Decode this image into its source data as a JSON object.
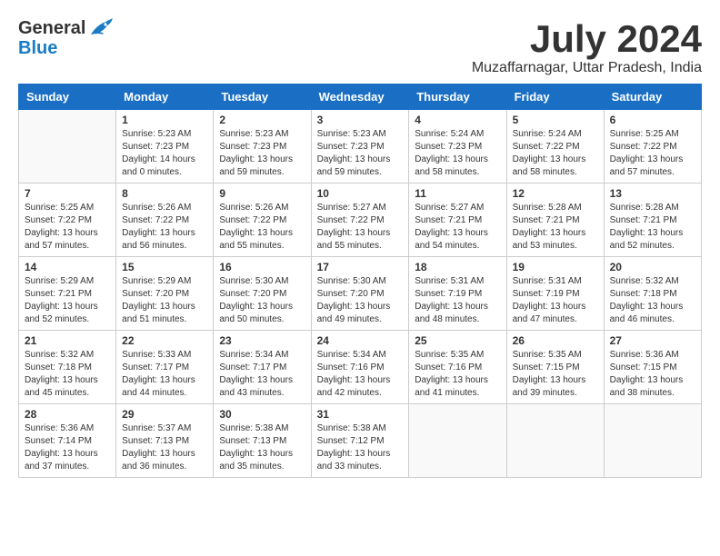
{
  "header": {
    "logo_general": "General",
    "logo_blue": "Blue",
    "month": "July 2024",
    "location": "Muzaffarnagar, Uttar Pradesh, India"
  },
  "weekdays": [
    "Sunday",
    "Monday",
    "Tuesday",
    "Wednesday",
    "Thursday",
    "Friday",
    "Saturday"
  ],
  "weeks": [
    [
      {
        "day": "",
        "info": ""
      },
      {
        "day": "1",
        "info": "Sunrise: 5:23 AM\nSunset: 7:23 PM\nDaylight: 14 hours\nand 0 minutes."
      },
      {
        "day": "2",
        "info": "Sunrise: 5:23 AM\nSunset: 7:23 PM\nDaylight: 13 hours\nand 59 minutes."
      },
      {
        "day": "3",
        "info": "Sunrise: 5:23 AM\nSunset: 7:23 PM\nDaylight: 13 hours\nand 59 minutes."
      },
      {
        "day": "4",
        "info": "Sunrise: 5:24 AM\nSunset: 7:23 PM\nDaylight: 13 hours\nand 58 minutes."
      },
      {
        "day": "5",
        "info": "Sunrise: 5:24 AM\nSunset: 7:22 PM\nDaylight: 13 hours\nand 58 minutes."
      },
      {
        "day": "6",
        "info": "Sunrise: 5:25 AM\nSunset: 7:22 PM\nDaylight: 13 hours\nand 57 minutes."
      }
    ],
    [
      {
        "day": "7",
        "info": "Sunrise: 5:25 AM\nSunset: 7:22 PM\nDaylight: 13 hours\nand 57 minutes."
      },
      {
        "day": "8",
        "info": "Sunrise: 5:26 AM\nSunset: 7:22 PM\nDaylight: 13 hours\nand 56 minutes."
      },
      {
        "day": "9",
        "info": "Sunrise: 5:26 AM\nSunset: 7:22 PM\nDaylight: 13 hours\nand 55 minutes."
      },
      {
        "day": "10",
        "info": "Sunrise: 5:27 AM\nSunset: 7:22 PM\nDaylight: 13 hours\nand 55 minutes."
      },
      {
        "day": "11",
        "info": "Sunrise: 5:27 AM\nSunset: 7:21 PM\nDaylight: 13 hours\nand 54 minutes."
      },
      {
        "day": "12",
        "info": "Sunrise: 5:28 AM\nSunset: 7:21 PM\nDaylight: 13 hours\nand 53 minutes."
      },
      {
        "day": "13",
        "info": "Sunrise: 5:28 AM\nSunset: 7:21 PM\nDaylight: 13 hours\nand 52 minutes."
      }
    ],
    [
      {
        "day": "14",
        "info": "Sunrise: 5:29 AM\nSunset: 7:21 PM\nDaylight: 13 hours\nand 52 minutes."
      },
      {
        "day": "15",
        "info": "Sunrise: 5:29 AM\nSunset: 7:20 PM\nDaylight: 13 hours\nand 51 minutes."
      },
      {
        "day": "16",
        "info": "Sunrise: 5:30 AM\nSunset: 7:20 PM\nDaylight: 13 hours\nand 50 minutes."
      },
      {
        "day": "17",
        "info": "Sunrise: 5:30 AM\nSunset: 7:20 PM\nDaylight: 13 hours\nand 49 minutes."
      },
      {
        "day": "18",
        "info": "Sunrise: 5:31 AM\nSunset: 7:19 PM\nDaylight: 13 hours\nand 48 minutes."
      },
      {
        "day": "19",
        "info": "Sunrise: 5:31 AM\nSunset: 7:19 PM\nDaylight: 13 hours\nand 47 minutes."
      },
      {
        "day": "20",
        "info": "Sunrise: 5:32 AM\nSunset: 7:18 PM\nDaylight: 13 hours\nand 46 minutes."
      }
    ],
    [
      {
        "day": "21",
        "info": "Sunrise: 5:32 AM\nSunset: 7:18 PM\nDaylight: 13 hours\nand 45 minutes."
      },
      {
        "day": "22",
        "info": "Sunrise: 5:33 AM\nSunset: 7:17 PM\nDaylight: 13 hours\nand 44 minutes."
      },
      {
        "day": "23",
        "info": "Sunrise: 5:34 AM\nSunset: 7:17 PM\nDaylight: 13 hours\nand 43 minutes."
      },
      {
        "day": "24",
        "info": "Sunrise: 5:34 AM\nSunset: 7:16 PM\nDaylight: 13 hours\nand 42 minutes."
      },
      {
        "day": "25",
        "info": "Sunrise: 5:35 AM\nSunset: 7:16 PM\nDaylight: 13 hours\nand 41 minutes."
      },
      {
        "day": "26",
        "info": "Sunrise: 5:35 AM\nSunset: 7:15 PM\nDaylight: 13 hours\nand 39 minutes."
      },
      {
        "day": "27",
        "info": "Sunrise: 5:36 AM\nSunset: 7:15 PM\nDaylight: 13 hours\nand 38 minutes."
      }
    ],
    [
      {
        "day": "28",
        "info": "Sunrise: 5:36 AM\nSunset: 7:14 PM\nDaylight: 13 hours\nand 37 minutes."
      },
      {
        "day": "29",
        "info": "Sunrise: 5:37 AM\nSunset: 7:13 PM\nDaylight: 13 hours\nand 36 minutes."
      },
      {
        "day": "30",
        "info": "Sunrise: 5:38 AM\nSunset: 7:13 PM\nDaylight: 13 hours\nand 35 minutes."
      },
      {
        "day": "31",
        "info": "Sunrise: 5:38 AM\nSunset: 7:12 PM\nDaylight: 13 hours\nand 33 minutes."
      },
      {
        "day": "",
        "info": ""
      },
      {
        "day": "",
        "info": ""
      },
      {
        "day": "",
        "info": ""
      }
    ]
  ]
}
